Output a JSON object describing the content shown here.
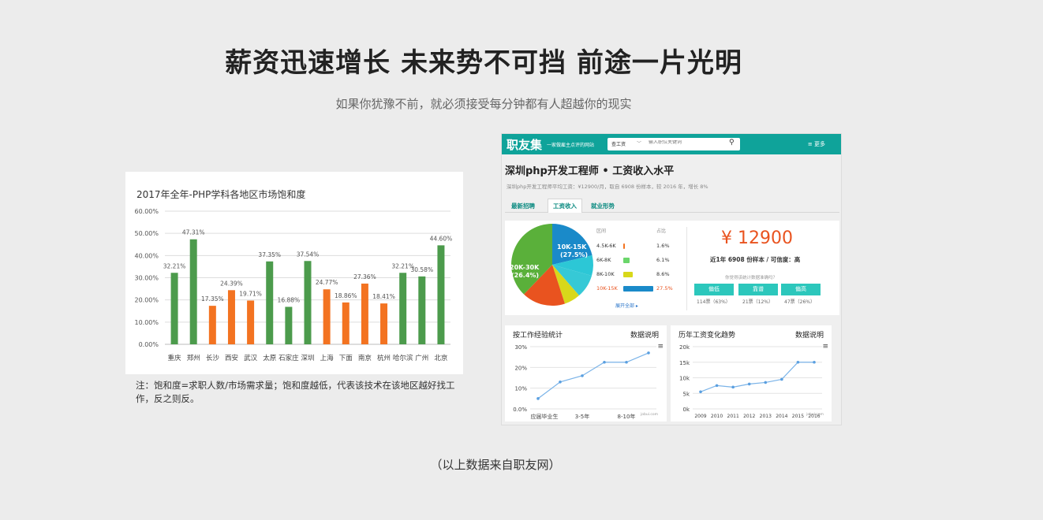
{
  "headline": "薪资迅速增长 未来势不可挡 前途一片光明",
  "subline": "如果你犹豫不前，就必须接受每分钟都有人超越你的现实",
  "chart_data": {
    "type": "bar",
    "title": "2017年全年-PHP学科各地区市场饱和度",
    "categories": [
      "重庆",
      "郑州",
      "长沙",
      "西安",
      "武汉",
      "太原",
      "石家庄",
      "深圳",
      "上海",
      "下面",
      "南京",
      "杭州",
      "哈尔滨",
      "广州",
      "北京"
    ],
    "values": [
      32.21,
      47.31,
      17.35,
      24.39,
      19.71,
      37.35,
      16.88,
      37.54,
      24.77,
      18.86,
      27.36,
      18.41,
      32.21,
      30.58,
      44.6
    ],
    "labels": [
      "32.21%",
      "47.31%",
      "17.35%",
      "24.39%",
      "19.71%",
      "37.35%",
      "16.88%",
      "37.54%",
      "24.77%",
      "18.86%",
      "27.36%",
      "18.41%",
      "32.21%",
      "30.58%",
      "44.60%"
    ],
    "bar_colors": [
      "#4c9b4c",
      "#4c9b4c",
      "#f37321",
      "#f37321",
      "#f37321",
      "#4c9b4c",
      "#4c9b4c",
      "#4c9b4c",
      "#f37321",
      "#f37321",
      "#f37321",
      "#f37321",
      "#4c9b4c",
      "#4c9b4c",
      "#4c9b4c"
    ],
    "yticks": [
      "0.00%",
      "10.00%",
      "20.00%",
      "30.00%",
      "40.00%",
      "50.00%",
      "60.00%"
    ],
    "ylim": [
      0,
      60
    ],
    "grid": true
  },
  "note": "注：饱和度=求职人数/市场需求量；饱和度越低，代表该技术在该地区越好找工作，反之则反。",
  "source": "（以上数据来自职友网）",
  "shot": {
    "logo": "职友集",
    "slogan": "一家做雇主点评的网站",
    "search_select": "查工资",
    "search_placeholder": "输入职位关键词",
    "more": "≡ 更多",
    "page_title": "深圳php开发工程师 • 工资收入水平",
    "page_sub": "深圳php开发工程师平均工资：¥12900/月，取自 6908 份样本，较 2016 年，增长 8%",
    "tabs": [
      "最新招聘",
      "工资收入",
      "就业形势"
    ],
    "pie_labels": [
      "10K-15K\n(27.5%)",
      "20K-30K\n(26.4%)"
    ],
    "pie_label_a1": "10K-15K",
    "pie_label_a2": "(27.5%)",
    "pie_label_b1": "20K-30K",
    "pie_label_b2": "(26.4%)",
    "table_head": [
      "区间",
      "占比"
    ],
    "rows": [
      {
        "range": "4.5K-6K",
        "pct": "1.6%",
        "color": "#f37321",
        "frac": 0.016
      },
      {
        "range": "6K-8K",
        "pct": "6.1%",
        "color": "#6bd66b",
        "frac": 0.061
      },
      {
        "range": "8K-10K",
        "pct": "8.6%",
        "color": "#d8d81a",
        "frac": 0.086
      },
      {
        "range": "10K-15K",
        "pct": "27.5%",
        "color": "#1a8ac9",
        "frac": 0.275
      }
    ],
    "show_all": "展开全部 ▸",
    "salary": "¥ 12900",
    "salary_desc": "近1年 6908 份样本 / 可信度：高",
    "salary_q": "你觉得该统计数据准确吗？",
    "votes": [
      {
        "label": "偏低",
        "count": "114票（63%）"
      },
      {
        "label": "靠谱",
        "count": "21票（12%）"
      },
      {
        "label": "偏高",
        "count": "47票（26%）"
      }
    ],
    "exp_chart": {
      "title": "按工作经验统计",
      "link": "数据说明",
      "yticks": [
        "0.0%",
        "10%",
        "20%",
        "30%"
      ],
      "xlabels": [
        "应届毕业生",
        "3-5年",
        "8-10年"
      ],
      "values": [
        5,
        13,
        16,
        22.5,
        22.5,
        27
      ],
      "watermark": "jobui.com"
    },
    "trend_chart": {
      "title": "历年工资变化趋势",
      "link": "数据说明",
      "yticks": [
        "0k",
        "5k",
        "10k",
        "15k",
        "20k"
      ],
      "years": [
        "2009",
        "2010",
        "2011",
        "2012",
        "2013",
        "2014",
        "2015",
        "2016"
      ],
      "values": [
        5.5,
        7.5,
        7,
        8,
        8.5,
        9.5,
        15,
        15
      ],
      "watermark": "jobui.com"
    }
  }
}
